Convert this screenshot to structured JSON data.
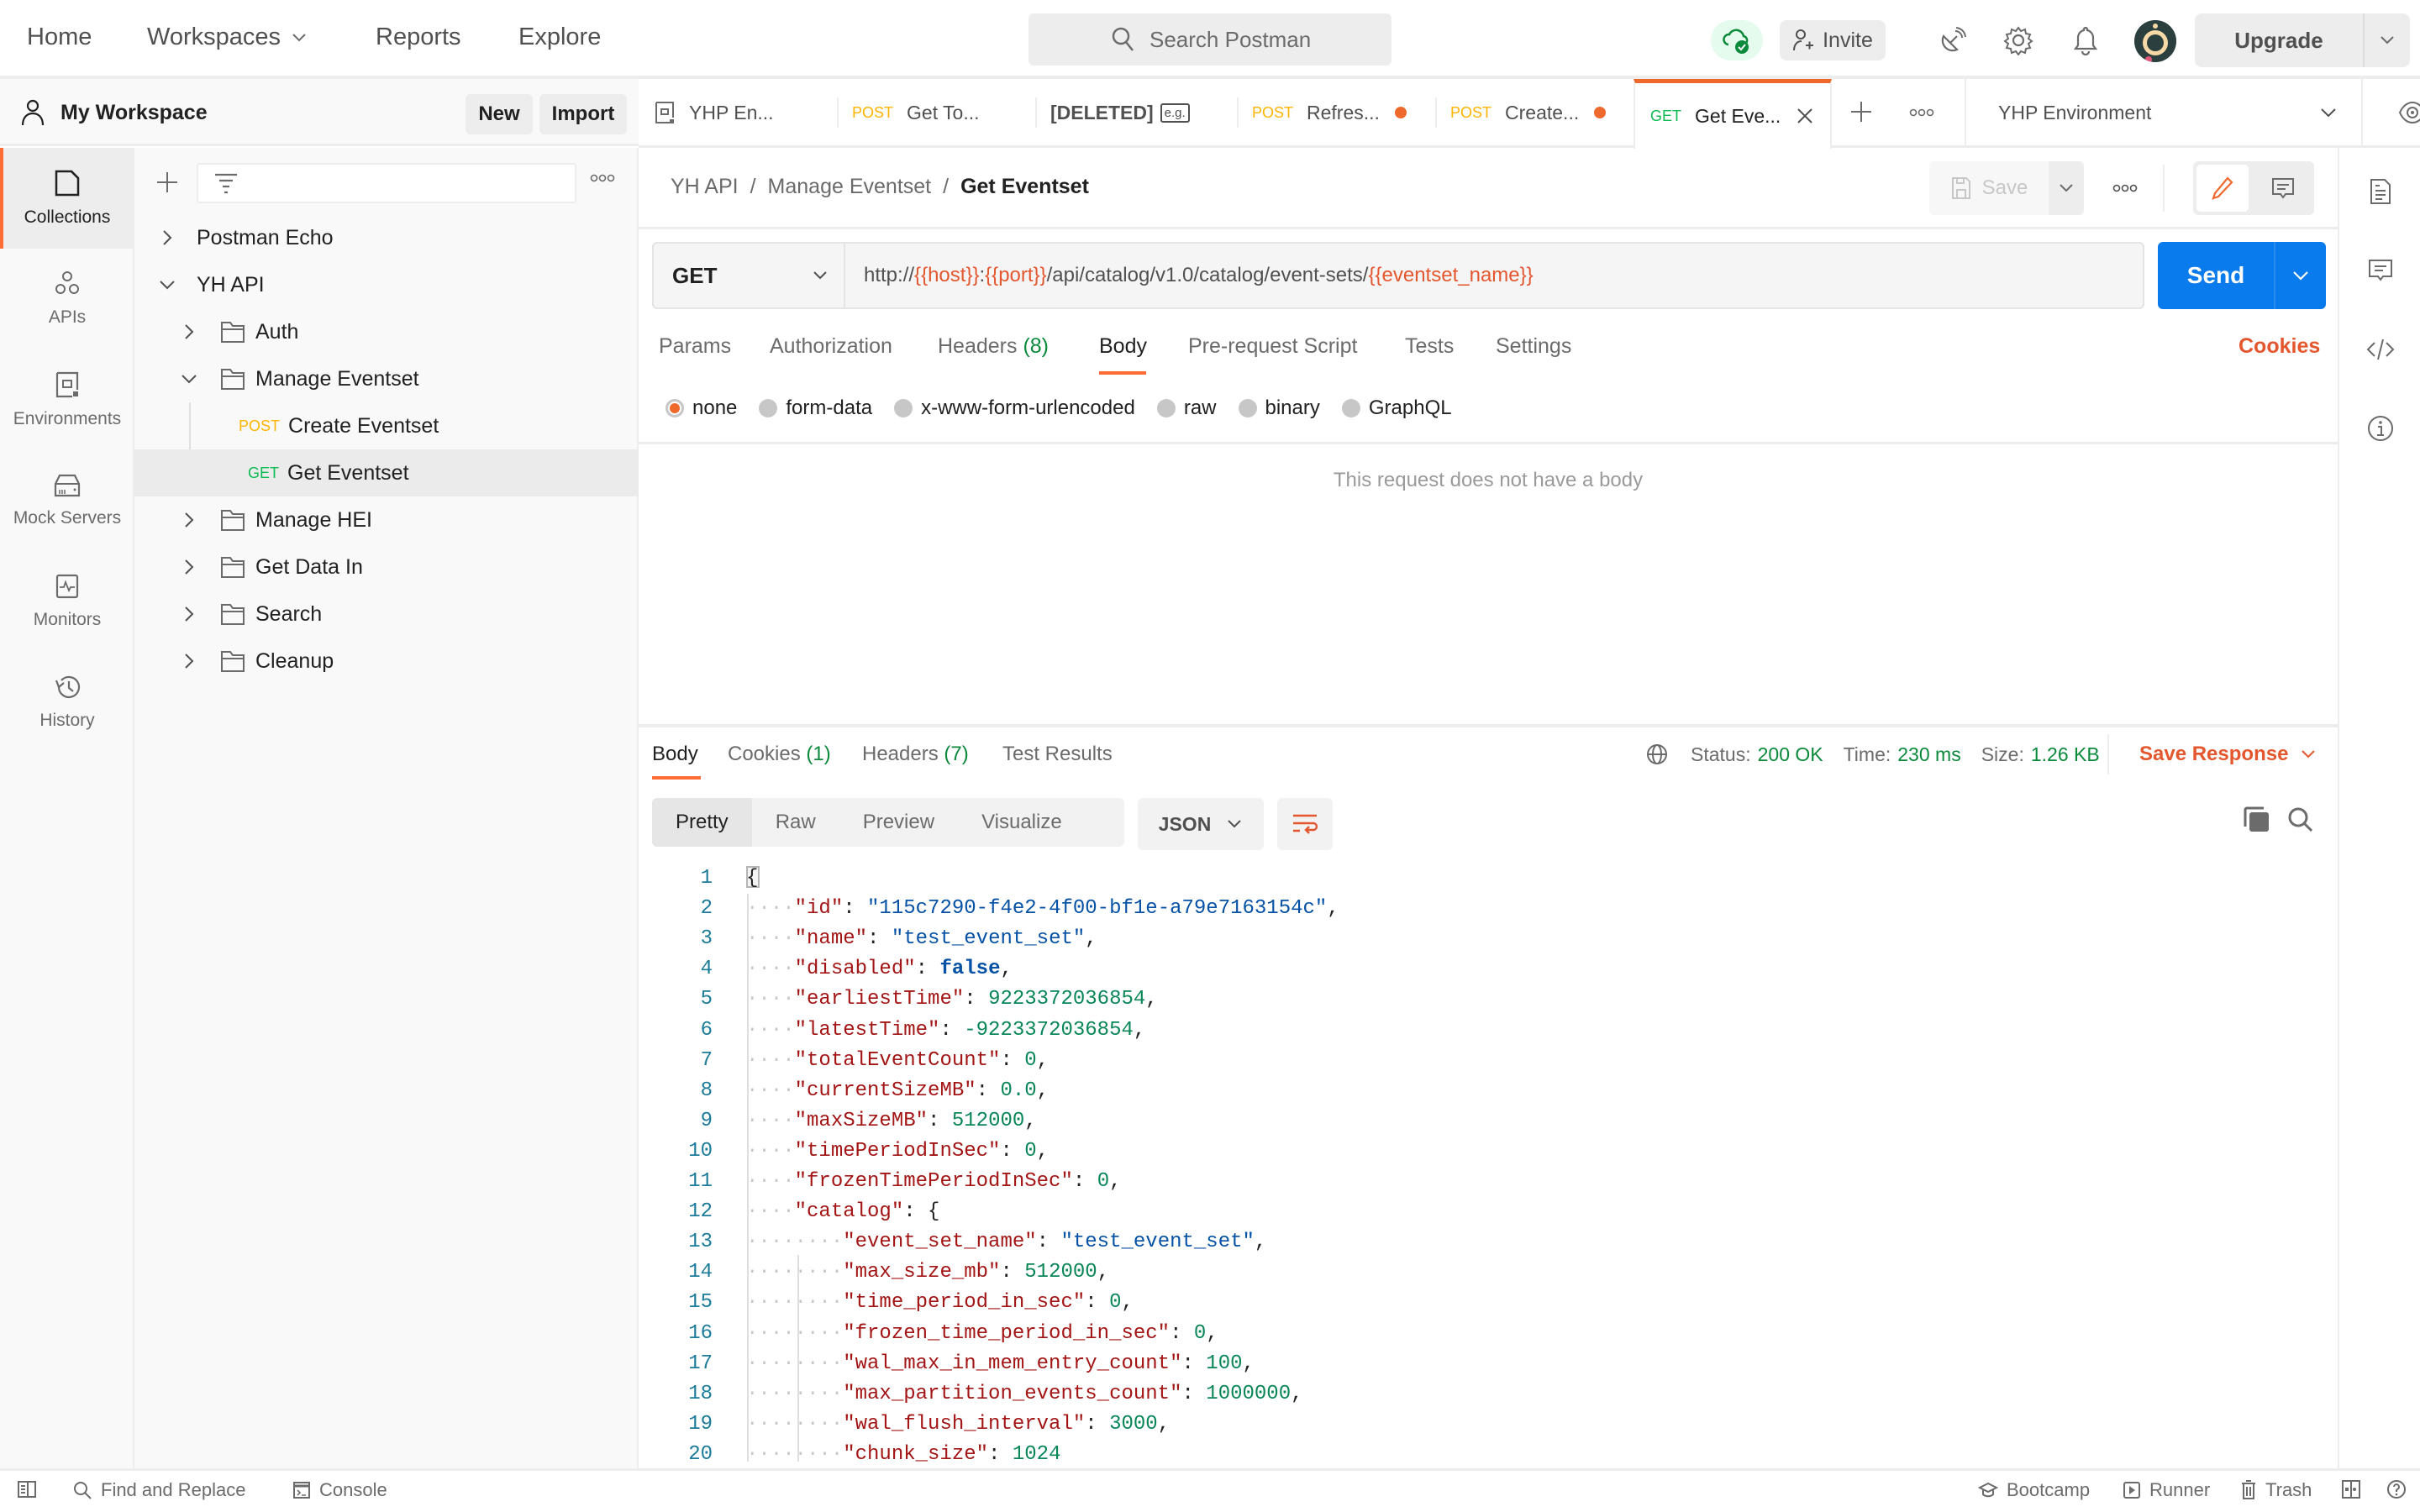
{
  "topbar": {
    "nav": [
      {
        "label": "Home"
      },
      {
        "label": "Workspaces"
      },
      {
        "label": "Reports"
      },
      {
        "label": "Explore"
      }
    ],
    "search_placeholder": "Search Postman",
    "invite_label": "Invite",
    "upgrade_label": "Upgrade",
    "icons": [
      "cloud-sync-icon",
      "satellite-icon",
      "settings-gear-icon",
      "bell-icon",
      "avatar"
    ]
  },
  "workspace": {
    "name": "My Workspace",
    "new_label": "New",
    "import_label": "Import"
  },
  "rail": {
    "items": [
      {
        "label": "Collections",
        "icon": "collections-icon",
        "active": true
      },
      {
        "label": "APIs",
        "icon": "apis-icon"
      },
      {
        "label": "Environments",
        "icon": "environments-icon"
      },
      {
        "label": "Mock Servers",
        "icon": "mock-servers-icon"
      },
      {
        "label": "Monitors",
        "icon": "monitors-icon"
      },
      {
        "label": "History",
        "icon": "history-icon"
      }
    ]
  },
  "tree": [
    {
      "label": "Postman Echo",
      "type": "collection",
      "expanded": false
    },
    {
      "label": "YH API",
      "type": "collection",
      "expanded": true
    },
    {
      "label": "Auth",
      "type": "folder",
      "expanded": false
    },
    {
      "label": "Manage Eventset",
      "type": "folder",
      "expanded": true
    },
    {
      "label": "Create Eventset",
      "type": "request",
      "method": "POST"
    },
    {
      "label": "Get Eventset",
      "type": "request",
      "method": "GET",
      "selected": true
    },
    {
      "label": "Manage HEI",
      "type": "folder",
      "expanded": false
    },
    {
      "label": "Get Data In",
      "type": "folder",
      "expanded": false
    },
    {
      "label": "Search",
      "type": "folder",
      "expanded": false
    },
    {
      "label": "Cleanup",
      "type": "folder",
      "expanded": false
    }
  ],
  "tabs": [
    {
      "label": "YHP En...",
      "icon": "environment-icon"
    },
    {
      "method": "POST",
      "label": "Get To..."
    },
    {
      "label": "[DELETED]",
      "badge": "e.g."
    },
    {
      "method": "POST",
      "label": "Refres...",
      "unsaved": true
    },
    {
      "method": "POST",
      "label": "Create...",
      "unsaved": true
    },
    {
      "method": "GET",
      "label": "Get Eve...",
      "active": true
    }
  ],
  "environment": {
    "selected": "YHP Environment"
  },
  "breadcrumb": [
    "YH API",
    "Manage Eventset",
    "Get Eventset"
  ],
  "request": {
    "save_label": "Save",
    "method": "GET",
    "url_parts": [
      {
        "text": "http://",
        "var": false
      },
      {
        "text": "{{host}}",
        "var": true
      },
      {
        "text": ":",
        "var": false
      },
      {
        "text": "{{port}}",
        "var": true
      },
      {
        "text": "/api/catalog/v1.0/catalog/event-sets/",
        "var": false
      },
      {
        "text": "{{eventset_name}}",
        "var": true
      }
    ],
    "send_label": "Send",
    "tabs": [
      {
        "label": "Params"
      },
      {
        "label": "Authorization"
      },
      {
        "label": "Headers",
        "count": "(8)"
      },
      {
        "label": "Body",
        "active": true
      },
      {
        "label": "Pre-request Script"
      },
      {
        "label": "Tests"
      },
      {
        "label": "Settings"
      }
    ],
    "cookies_label": "Cookies",
    "body_types": [
      {
        "label": "none",
        "selected": true
      },
      {
        "label": "form-data"
      },
      {
        "label": "x-www-form-urlencoded"
      },
      {
        "label": "raw"
      },
      {
        "label": "binary"
      },
      {
        "label": "GraphQL"
      }
    ],
    "empty_body_message": "This request does not have a body"
  },
  "response": {
    "tabs": [
      {
        "label": "Body",
        "active": true
      },
      {
        "label": "Cookies",
        "count": "(1)"
      },
      {
        "label": "Headers",
        "count": "(7)"
      },
      {
        "label": "Test Results"
      }
    ],
    "status_label": "Status:",
    "status_value": "200 OK",
    "time_label": "Time:",
    "time_value": "230 ms",
    "size_label": "Size:",
    "size_value": "1.26 KB",
    "save_response_label": "Save Response",
    "views": [
      "Pretty",
      "Raw",
      "Preview",
      "Visualize"
    ],
    "active_view": "Pretty",
    "format": "JSON",
    "lines": [
      [
        {
          "t": "p",
          "v": "{"
        }
      ],
      [
        {
          "t": "w",
          "v": "····"
        },
        {
          "t": "k",
          "v": "\"id\""
        },
        {
          "t": "p",
          "v": ": "
        },
        {
          "t": "s",
          "v": "\"115c7290-f4e2-4f00-bf1e-a79e7163154c\""
        },
        {
          "t": "p",
          "v": ","
        }
      ],
      [
        {
          "t": "w",
          "v": "····"
        },
        {
          "t": "k",
          "v": "\"name\""
        },
        {
          "t": "p",
          "v": ": "
        },
        {
          "t": "s",
          "v": "\"test_event_set\""
        },
        {
          "t": "p",
          "v": ","
        }
      ],
      [
        {
          "t": "w",
          "v": "····"
        },
        {
          "t": "k",
          "v": "\"disabled\""
        },
        {
          "t": "p",
          "v": ": "
        },
        {
          "t": "b",
          "v": "false"
        },
        {
          "t": "p",
          "v": ","
        }
      ],
      [
        {
          "t": "w",
          "v": "····"
        },
        {
          "t": "k",
          "v": "\"earliestTime\""
        },
        {
          "t": "p",
          "v": ": "
        },
        {
          "t": "n",
          "v": "9223372036854"
        },
        {
          "t": "p",
          "v": ","
        }
      ],
      [
        {
          "t": "w",
          "v": "····"
        },
        {
          "t": "k",
          "v": "\"latestTime\""
        },
        {
          "t": "p",
          "v": ": "
        },
        {
          "t": "n",
          "v": "-9223372036854"
        },
        {
          "t": "p",
          "v": ","
        }
      ],
      [
        {
          "t": "w",
          "v": "····"
        },
        {
          "t": "k",
          "v": "\"totalEventCount\""
        },
        {
          "t": "p",
          "v": ": "
        },
        {
          "t": "n",
          "v": "0"
        },
        {
          "t": "p",
          "v": ","
        }
      ],
      [
        {
          "t": "w",
          "v": "····"
        },
        {
          "t": "k",
          "v": "\"currentSizeMB\""
        },
        {
          "t": "p",
          "v": ": "
        },
        {
          "t": "n",
          "v": "0.0"
        },
        {
          "t": "p",
          "v": ","
        }
      ],
      [
        {
          "t": "w",
          "v": "····"
        },
        {
          "t": "k",
          "v": "\"maxSizeMB\""
        },
        {
          "t": "p",
          "v": ": "
        },
        {
          "t": "n",
          "v": "512000"
        },
        {
          "t": "p",
          "v": ","
        }
      ],
      [
        {
          "t": "w",
          "v": "····"
        },
        {
          "t": "k",
          "v": "\"timePeriodInSec\""
        },
        {
          "t": "p",
          "v": ": "
        },
        {
          "t": "n",
          "v": "0"
        },
        {
          "t": "p",
          "v": ","
        }
      ],
      [
        {
          "t": "w",
          "v": "····"
        },
        {
          "t": "k",
          "v": "\"frozenTimePeriodInSec\""
        },
        {
          "t": "p",
          "v": ": "
        },
        {
          "t": "n",
          "v": "0"
        },
        {
          "t": "p",
          "v": ","
        }
      ],
      [
        {
          "t": "w",
          "v": "····"
        },
        {
          "t": "k",
          "v": "\"catalog\""
        },
        {
          "t": "p",
          "v": ": {"
        }
      ],
      [
        {
          "t": "w",
          "v": "········"
        },
        {
          "t": "k",
          "v": "\"event_set_name\""
        },
        {
          "t": "p",
          "v": ": "
        },
        {
          "t": "s",
          "v": "\"test_event_set\""
        },
        {
          "t": "p",
          "v": ","
        }
      ],
      [
        {
          "t": "w",
          "v": "········"
        },
        {
          "t": "k",
          "v": "\"max_size_mb\""
        },
        {
          "t": "p",
          "v": ": "
        },
        {
          "t": "n",
          "v": "512000"
        },
        {
          "t": "p",
          "v": ","
        }
      ],
      [
        {
          "t": "w",
          "v": "········"
        },
        {
          "t": "k",
          "v": "\"time_period_in_sec\""
        },
        {
          "t": "p",
          "v": ": "
        },
        {
          "t": "n",
          "v": "0"
        },
        {
          "t": "p",
          "v": ","
        }
      ],
      [
        {
          "t": "w",
          "v": "········"
        },
        {
          "t": "k",
          "v": "\"frozen_time_period_in_sec\""
        },
        {
          "t": "p",
          "v": ": "
        },
        {
          "t": "n",
          "v": "0"
        },
        {
          "t": "p",
          "v": ","
        }
      ],
      [
        {
          "t": "w",
          "v": "········"
        },
        {
          "t": "k",
          "v": "\"wal_max_in_mem_entry_count\""
        },
        {
          "t": "p",
          "v": ": "
        },
        {
          "t": "n",
          "v": "100"
        },
        {
          "t": "p",
          "v": ","
        }
      ],
      [
        {
          "t": "w",
          "v": "········"
        },
        {
          "t": "k",
          "v": "\"max_partition_events_count\""
        },
        {
          "t": "p",
          "v": ": "
        },
        {
          "t": "n",
          "v": "1000000"
        },
        {
          "t": "p",
          "v": ","
        }
      ],
      [
        {
          "t": "w",
          "v": "········"
        },
        {
          "t": "k",
          "v": "\"wal_flush_interval\""
        },
        {
          "t": "p",
          "v": ": "
        },
        {
          "t": "n",
          "v": "3000"
        },
        {
          "t": "p",
          "v": ","
        }
      ],
      [
        {
          "t": "w",
          "v": "········"
        },
        {
          "t": "k",
          "v": "\"chunk_size\""
        },
        {
          "t": "p",
          "v": ": "
        },
        {
          "t": "n",
          "v": "1024"
        }
      ]
    ]
  },
  "footer": {
    "left": [
      {
        "label": "",
        "icon": "sidebar-toggle-icon"
      },
      {
        "label": "Find and Replace",
        "icon": "search-icon"
      },
      {
        "label": "Console",
        "icon": "console-icon"
      }
    ],
    "right": [
      {
        "label": "Bootcamp",
        "icon": "bootcamp-icon"
      },
      {
        "label": "Runner",
        "icon": "runner-icon"
      },
      {
        "label": "Trash",
        "icon": "trash-icon"
      },
      {
        "label": "",
        "icon": "two-pane-icon"
      },
      {
        "label": "",
        "icon": "help-icon"
      }
    ]
  },
  "colors": {
    "accent": "#ff6c37",
    "send": "#097bed",
    "get": "#0cbb52",
    "post": "#ffb400",
    "ok": "#0b8a3c",
    "variable": "#e4572e"
  }
}
